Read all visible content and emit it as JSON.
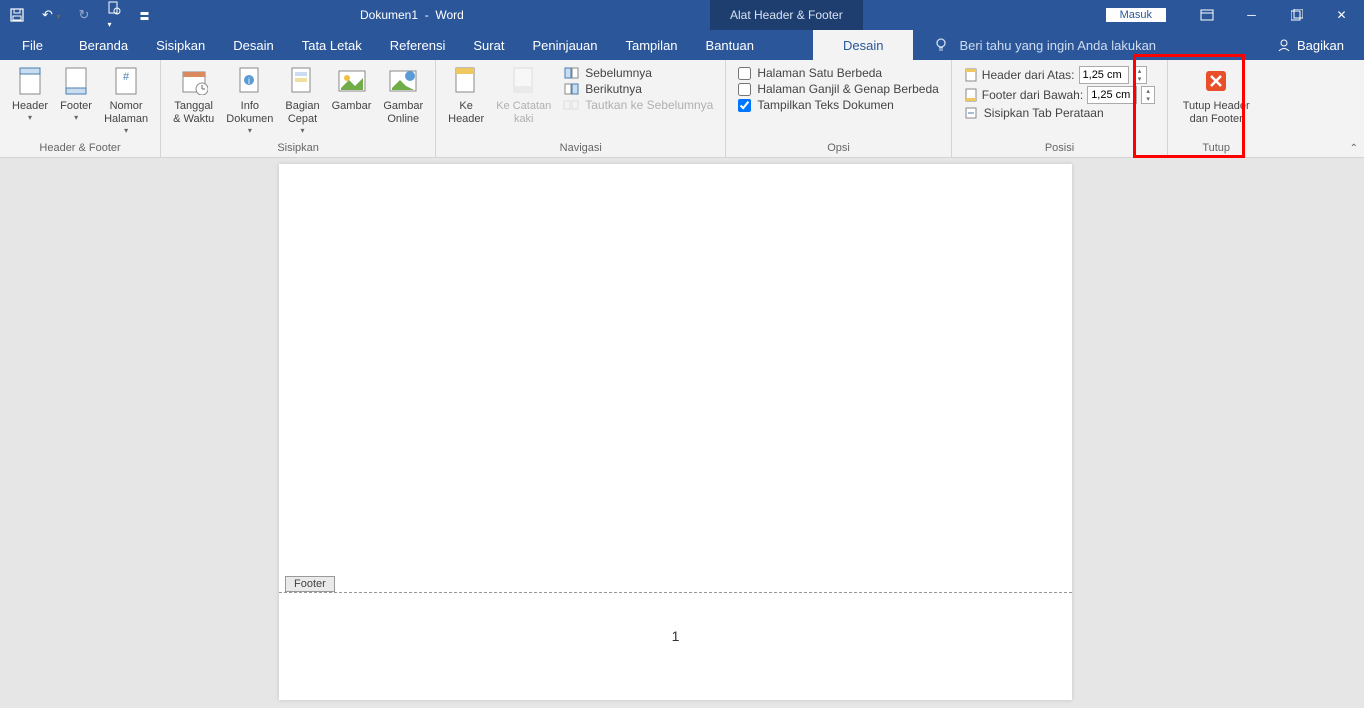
{
  "title": {
    "doc": "Dokumen1",
    "app": "Word",
    "contextual": "Alat Header & Footer"
  },
  "window": {
    "masuk": "Masuk"
  },
  "menu": {
    "file": "File",
    "items": [
      "Beranda",
      "Sisipkan",
      "Desain",
      "Tata Letak",
      "Referensi",
      "Surat",
      "Peninjauan",
      "Tampilan",
      "Bantuan"
    ],
    "active": "Desain",
    "tellme": "Beri tahu yang ingin Anda lakukan",
    "bagikan": "Bagikan"
  },
  "ribbon": {
    "hf": {
      "header": "Header",
      "footer": "Footer",
      "nomor": "Nomor\nHalaman",
      "label": "Header & Footer"
    },
    "sisipkan": {
      "tanggal": "Tanggal\n& Waktu",
      "info": "Info\nDokumen",
      "bagian": "Bagian\nCepat",
      "gambar": "Gambar",
      "gambaronline": "Gambar\nOnline",
      "label": "Sisipkan"
    },
    "nav": {
      "keheader": "Ke\nHeader",
      "kecatatan": "Ke Catatan\nkaki",
      "sebelumnya": "Sebelumnya",
      "berikutnya": "Berikutnya",
      "tautkan": "Tautkan ke Sebelumnya",
      "label": "Navigasi"
    },
    "opsi": {
      "halsatu": "Halaman Satu Berbeda",
      "halganjil": "Halaman Ganjil & Genap Berbeda",
      "tampilkan": "Tampilkan Teks Dokumen",
      "label": "Opsi"
    },
    "posisi": {
      "headerdari": "Header dari Atas:",
      "footerdari": "Footer dari Bawah:",
      "sisipkantab": "Sisipkan Tab Perataan",
      "val": "1,25 cm",
      "label": "Posisi"
    },
    "tutup": {
      "btn": "Tutup Header\ndan Footer",
      "label": "Tutup"
    }
  },
  "page": {
    "footer_tag": "Footer",
    "page_num": "1"
  }
}
